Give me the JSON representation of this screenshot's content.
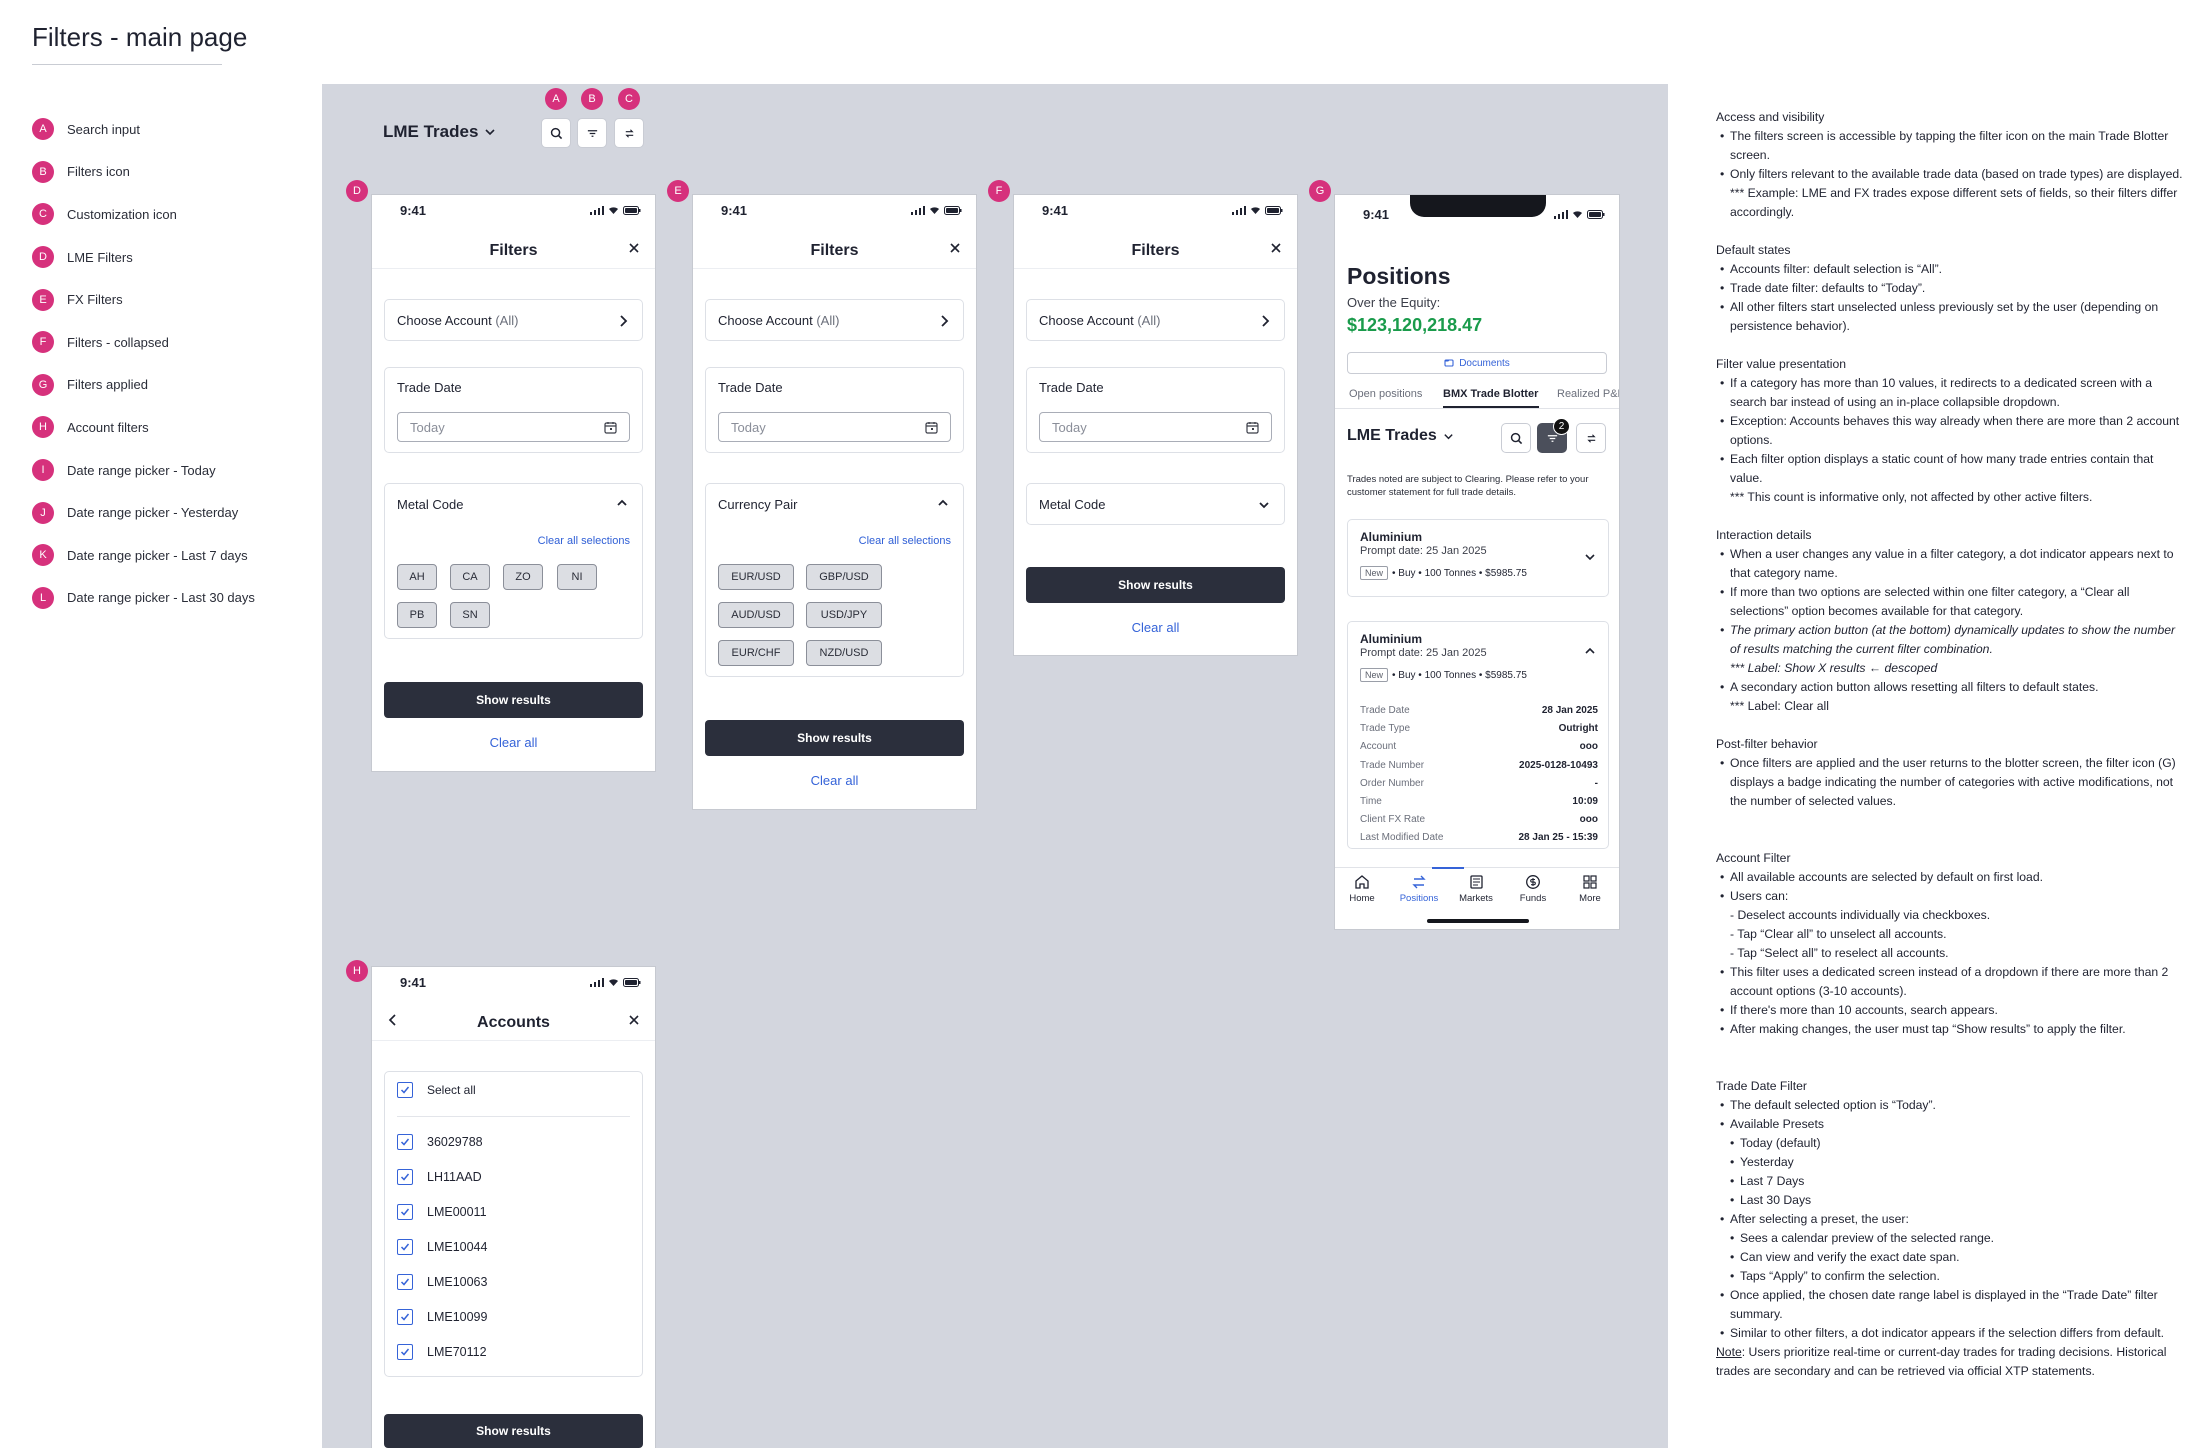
{
  "page": {
    "title": "Filters - main page"
  },
  "legend": [
    {
      "key": "A",
      "label": "Search input"
    },
    {
      "key": "B",
      "label": "Filters icon"
    },
    {
      "key": "C",
      "label": "Customization icon"
    },
    {
      "key": "D",
      "label": "LME Filters"
    },
    {
      "key": "E",
      "label": "FX Filters"
    },
    {
      "key": "F",
      "label": "Filters - collapsed"
    },
    {
      "key": "G",
      "label": "Filters applied"
    },
    {
      "key": "H",
      "label": "Account filters"
    },
    {
      "key": "I",
      "label": "Date range picker - Today"
    },
    {
      "key": "J",
      "label": "Date range picker - Yesterday"
    },
    {
      "key": "K",
      "label": "Date range picker - Last 7 days"
    },
    {
      "key": "L",
      "label": "Date range picker - Last 30 days"
    }
  ],
  "canvas_header": {
    "title": "LME Trades",
    "markers": {
      "a": "A",
      "b": "B",
      "c": "C"
    },
    "icons": [
      "search-icon",
      "filter-icon",
      "customize-icon"
    ]
  },
  "colors": {
    "marker": "#d6317c",
    "canvas": "#d3d6de",
    "primary": "#2b2f3c",
    "link": "#3563d8",
    "equity": "#1a9b4b"
  },
  "common": {
    "time": "9:41",
    "filters_title": "Filters",
    "choose_account_label": "Choose Account",
    "choose_account_suffix": "(All)",
    "trade_date_label": "Trade Date",
    "date_placeholder": "Today",
    "clear_all_selections": "Clear all selections",
    "show_results": "Show results",
    "clear_all": "Clear all"
  },
  "screen_d": {
    "marker": "D",
    "section": "Metal Code",
    "chips": [
      "AH",
      "CA",
      "ZO",
      "NI",
      "PB",
      "SN"
    ]
  },
  "screen_e": {
    "marker": "E",
    "section": "Currency Pair",
    "chips": [
      "EUR/USD",
      "GBP/USD",
      "AUD/USD",
      "USD/JPY",
      "EUR/CHF",
      "NZD/USD"
    ]
  },
  "screen_f": {
    "marker": "F",
    "section": "Metal Code"
  },
  "screen_g": {
    "marker": "G",
    "title": "Positions",
    "equity_label": "Over the Equity:",
    "equity_value": "$123,120,218.47",
    "documents": "Documents",
    "tabs": [
      "Open positions",
      "BMX Trade Blotter",
      "Realized P&L"
    ],
    "section_title": "LME Trades",
    "filter_badge": "2",
    "disclaimer": "Trades noted are subject to Clearing. Please refer to your customer statement for full trade details.",
    "trade1": {
      "name": "Aluminium",
      "prompt": "Prompt date: 25 Jan 2025",
      "tag": "New",
      "summary": "• Buy • 100 Tonnes • $5985.75"
    },
    "trade2": {
      "name": "Aluminium",
      "prompt": "Prompt date: 25 Jan 2025",
      "tag": "New",
      "summary": "• Buy • 100 Tonnes • $5985.75",
      "details": [
        {
          "k": "Trade Date",
          "v": "28 Jan 2025"
        },
        {
          "k": "Trade Type",
          "v": "Outright"
        },
        {
          "k": "Account",
          "v": "ooo"
        },
        {
          "k": "Trade Number",
          "v": "2025-0128-10493"
        },
        {
          "k": "Order Number",
          "v": "-"
        },
        {
          "k": "Time",
          "v": "10:09"
        },
        {
          "k": "Client FX Rate",
          "v": "ooo"
        },
        {
          "k": "Last Modified Date",
          "v": "28 Jan 25 - 15:39"
        }
      ]
    },
    "nav": [
      "Home",
      "Positions",
      "Markets",
      "Funds",
      "More"
    ]
  },
  "screen_h": {
    "marker": "H",
    "title": "Accounts",
    "select_all": "Select all",
    "accounts": [
      "36029788",
      "LH11AAD",
      "LME00011",
      "LME10044",
      "LME10063",
      "LME10099",
      "LME70112"
    ]
  },
  "notes": {
    "access": {
      "title": "Access and visibility",
      "lines": [
        "The filters screen is accessible by tapping the filter icon on the main Trade Blotter screen.",
        "Only filters relevant to the available trade data (based on trade types) are displayed.",
        "*** Example: LME and FX trades expose different sets of fields, so their filters differ accordingly."
      ]
    },
    "defaults": {
      "title": "Default states",
      "lines": [
        "Accounts filter: default selection is “All”.",
        "Trade date filter: defaults to “Today”.",
        "All other filters start unselected unless previously set by the user (depending on persistence behavior)."
      ]
    },
    "presentation": {
      "title": "Filter value presentation",
      "lines": [
        "If a category has more than 10 values, it redirects to a dedicated screen with a search bar instead of using an in-place collapsible dropdown.",
        "Exception: Accounts behaves this way already when there are more than 2 account options.",
        "Each filter option displays a static count of how many trade entries contain that value.",
        "*** This count is informative only, not affected by other active filters."
      ]
    },
    "interaction": {
      "title": "Interaction details",
      "lines": [
        "When a user changes any value in a filter category, a dot indicator appears next to that category name.",
        "If more than two options are selected within one filter category, a “Clear all selections” option becomes available for that category.",
        "The primary action button (at the bottom) dynamically updates to show the number of results matching the current filter combination.",
        "*** Label: Show X results  ← descoped",
        "A secondary action button allows resetting all filters to default states.",
        "*** Label: Clear all"
      ]
    },
    "post": {
      "title": "Post-filter behavior",
      "lines": [
        "Once filters are applied and the user returns to the blotter screen, the filter icon (G) displays a badge indicating the number of categories with active modifications, not the number of selected values."
      ]
    },
    "account": {
      "title": "Account Filter",
      "lines": [
        "All available accounts are selected by default on first load.",
        "Users can:",
        "- Deselect accounts individually via checkboxes.",
        "- Tap “Clear all” to unselect all accounts.",
        "- Tap “Select all” to reselect all accounts.",
        "This filter uses a dedicated screen instead of a dropdown if there are more than 2 account options (3-10 accounts).",
        "If there's more than 10 accounts, search appears.",
        "After making changes, the user must tap “Show results” to apply the filter."
      ]
    },
    "tradedate": {
      "title": "Trade Date Filter",
      "lines": [
        "The default selected option is “Today”.",
        "Available Presets",
        "Today (default)",
        "Yesterday",
        "Last 7 Days",
        "Last 30 Days",
        "After selecting a preset, the user:",
        "Sees a calendar preview of the selected range.",
        "Can view and verify the exact date span.",
        "Taps “Apply” to confirm the selection.",
        "Once applied, the chosen date range label is displayed in the “Trade Date” filter summary.",
        "Similar to other filters, a dot indicator appears if the selection differs from default."
      ],
      "note_label": "Note",
      "note_text": ": Users prioritize real-time or current-day trades for trading decisions. Historical trades are secondary and can be retrieved via official XTP statements."
    }
  }
}
